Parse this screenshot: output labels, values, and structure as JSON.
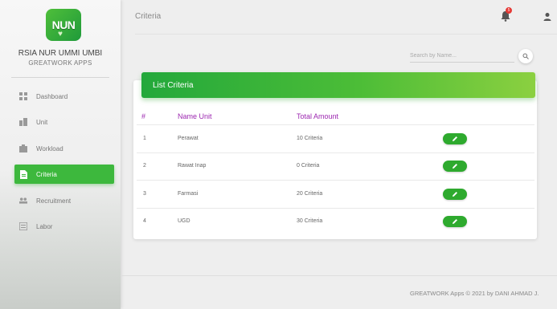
{
  "brand": {
    "logo_text": "NUN",
    "name": "RSIA NUR UMMI UMBI",
    "subtitle": "GREATWORK APPS"
  },
  "sidebar": {
    "items": [
      {
        "label": "Dashboard",
        "icon": "dashboard-icon",
        "active": false
      },
      {
        "label": "Unit",
        "icon": "unit-icon",
        "active": false
      },
      {
        "label": "Workload",
        "icon": "workload-icon",
        "active": false
      },
      {
        "label": "Criteria",
        "icon": "document-icon",
        "active": true
      },
      {
        "label": "Recruitment",
        "icon": "recruitment-icon",
        "active": false
      },
      {
        "label": "Labor",
        "icon": "labor-icon",
        "active": false
      }
    ]
  },
  "header": {
    "title": "Criteria",
    "notification_count": "5"
  },
  "search": {
    "placeholder": "Search by Name..."
  },
  "card": {
    "title": "List Criteria",
    "columns": [
      "#",
      "Name Unit",
      "Total Amount"
    ],
    "rows": [
      {
        "no": "1",
        "name": "Perawat",
        "total": "10 Criteria"
      },
      {
        "no": "2",
        "name": "Rawat Inap",
        "total": "0 Criteria"
      },
      {
        "no": "3",
        "name": "Farmasi",
        "total": "20 Criteria"
      },
      {
        "no": "4",
        "name": "UGD",
        "total": "30 Criteria"
      }
    ]
  },
  "footer": {
    "text": "GREATWORK Apps © 2021 by DANI AHMAD J."
  },
  "colors": {
    "accent": "#3db83d",
    "header_gradient_start": "#23a83b",
    "header_gradient_end": "#8bd040",
    "column_header": "#9c27b0",
    "badge": "#e53935"
  }
}
